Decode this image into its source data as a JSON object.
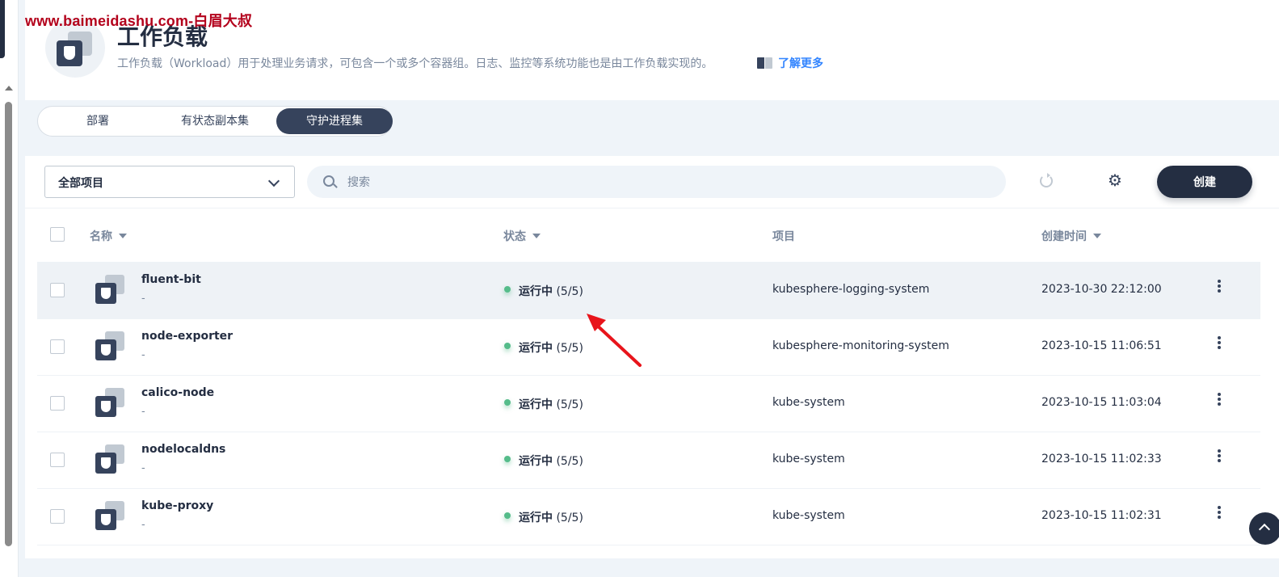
{
  "watermark": "www.baimeidashu.com-白眉大叔",
  "header": {
    "title": "工作负载",
    "description": "工作负载（Workload）用于处理业务请求，可包含一个或多个容器组。日志、监控等系统功能也是由工作负载实现的。",
    "learn_more": "了解更多",
    "icon": "workload-icon"
  },
  "tabs": [
    {
      "label": "部署",
      "active": false
    },
    {
      "label": "有状态副本集",
      "active": false
    },
    {
      "label": "守护进程集",
      "active": true
    }
  ],
  "toolbar": {
    "project_select": "全部项目",
    "search_placeholder": "搜索",
    "create_label": "创建",
    "refresh_icon": "refresh-icon",
    "settings_icon": "gear-icon"
  },
  "table": {
    "columns": [
      "名称",
      "状态",
      "项目",
      "创建时间"
    ],
    "rows": [
      {
        "name": "fluent-bit",
        "sub": "-",
        "status": "运行中",
        "count": "(5/5)",
        "project": "kubesphere-logging-system",
        "created": "2023-10-30 22:12:00"
      },
      {
        "name": "node-exporter",
        "sub": "-",
        "status": "运行中",
        "count": "(5/5)",
        "project": "kubesphere-monitoring-system",
        "created": "2023-10-15 11:06:51"
      },
      {
        "name": "calico-node",
        "sub": "-",
        "status": "运行中",
        "count": "(5/5)",
        "project": "kube-system",
        "created": "2023-10-15 11:03:04"
      },
      {
        "name": "nodelocaldns",
        "sub": "-",
        "status": "运行中",
        "count": "(5/5)",
        "project": "kube-system",
        "created": "2023-10-15 11:02:33"
      },
      {
        "name": "kube-proxy",
        "sub": "-",
        "status": "运行中",
        "count": "(5/5)",
        "project": "kube-system",
        "created": "2023-10-15 11:02:31"
      }
    ]
  },
  "colors": {
    "primary_dark": "#242e42",
    "status_running": "#55bc8a",
    "link": "#3385ff",
    "annotation_arrow": "#e8141b"
  }
}
